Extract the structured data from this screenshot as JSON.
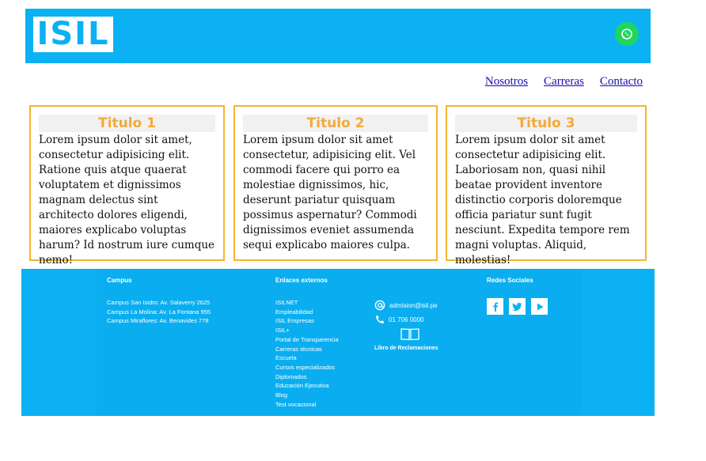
{
  "header": {
    "logo_text": "ISIL",
    "whatsapp_icon": "whatsapp-icon",
    "colors": {
      "brand": "#0bb1f3",
      "whatsapp": "#1ed760"
    }
  },
  "nav": {
    "items": [
      "Nosotros",
      "Carreras",
      "Contacto"
    ]
  },
  "cards": [
    {
      "title": "Titulo 1",
      "body": "Lorem ipsum dolor sit amet, consectetur adipisicing elit. Ratione quis atque quaerat voluptatem et dignissimos magnam delectus sint architecto dolores eligendi, maiores explicabo voluptas harum? Id nostrum iure cumque nemo!"
    },
    {
      "title": "Titulo 2",
      "body": "Lorem ipsum dolor sit amet consectetur, adipisicing elit. Vel commodi facere qui porro ea molestiae dignissimos, hic, deserunt pariatur quisquam possimus aspernatur? Commodi dignissimos eveniet assumenda sequi explicabo maiores culpa."
    },
    {
      "title": "Titulo 3",
      "body": "Lorem ipsum dolor sit amet consectetur adipisicing elit. Laboriosam non, quasi nihil beatae provident inventore distinctio corporis doloremque officia pariatur sunt fugit nesciunt. Expedita tempore rem magni voluptas. Aliquid, molestias!"
    }
  ],
  "footer": {
    "campus": {
      "heading": "Campus",
      "items": [
        "Campus San Isidro: Av. Salaverry 2625",
        "Campus La Molina: Av. La Fontana 955",
        "Campus Miraflores: Av. Benavides 778"
      ]
    },
    "links": {
      "heading": "Enlaces externos",
      "items": [
        "ISILNET",
        "Empleabilidad",
        "ISIL Empresas",
        "ISIL+",
        "Portal de Transparencia",
        "Carreras técnicas",
        "Escuela",
        "Cursos especializados",
        "Diplomados",
        "Educación Ejecutiva",
        "Blog",
        "Test vocacional"
      ]
    },
    "contact": {
      "email": "admision@isil.pe",
      "phone": "01 706 0000",
      "reclamos": "Libro de Reclamaciones",
      "icons": [
        "at-icon",
        "phone-icon",
        "book-icon"
      ]
    },
    "social": {
      "heading": "Redes Sociales",
      "icons": [
        "facebook-icon",
        "twitter-icon",
        "youtube-icon"
      ]
    }
  }
}
